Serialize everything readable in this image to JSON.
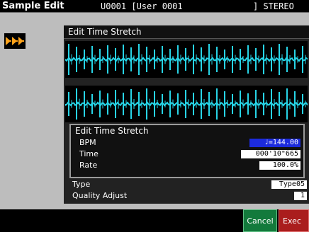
{
  "header": {
    "title": "Sample Edit",
    "sample_id": "U0001 [User 0001",
    "channel_mode": "] STEREO"
  },
  "panel": {
    "title": "Edit Time Stretch"
  },
  "time_stretch": {
    "title": "Edit Time Stretch",
    "bpm_label": "BPM",
    "bpm_value": "♩=144.00",
    "time_label": "Time",
    "time_value": "000'10\"665",
    "rate_label": "Rate",
    "rate_value": "100.0%"
  },
  "type": {
    "label": "Type",
    "value": "Type05"
  },
  "quality_adjust": {
    "label": "Quality Adjust",
    "value": "1"
  },
  "buttons": {
    "cancel": "Cancel",
    "exec": "Exec"
  },
  "colors": {
    "waveform": "#27d4e6",
    "selected": "#1c2bdc",
    "cancel": "#137a3c",
    "exec": "#aa1d1d",
    "play_icon": "#ffa31a"
  },
  "icons": {
    "left": "triple-play-arrow-icon"
  }
}
